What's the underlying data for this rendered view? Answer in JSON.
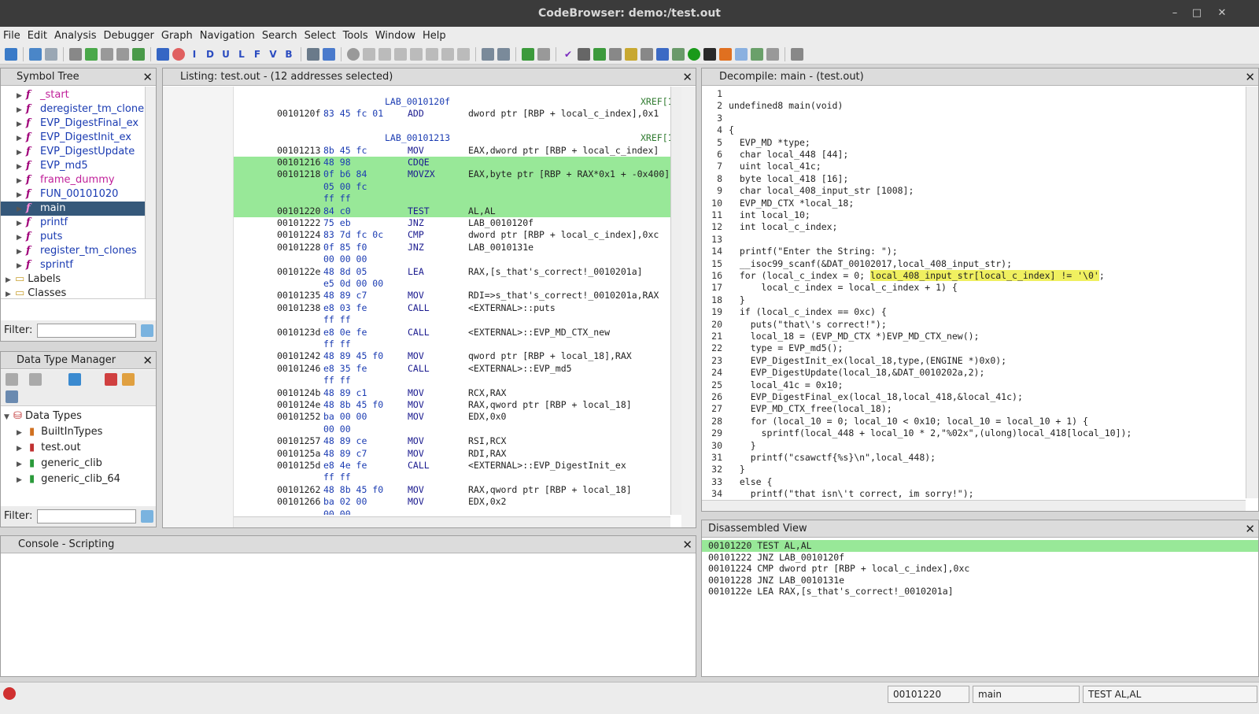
{
  "window": {
    "title": "CodeBrowser: demo:/test.out"
  },
  "menu": [
    "File",
    "Edit",
    "Analysis",
    "Debugger",
    "Graph",
    "Navigation",
    "Search",
    "Select",
    "Tools",
    "Window",
    "Help"
  ],
  "symbol_tree": {
    "title": "Symbol Tree",
    "items": [
      {
        "label": "_start",
        "kind": "fn"
      },
      {
        "label": "deregister_tm_clone",
        "kind": "fn"
      },
      {
        "label": "EVP_DigestFinal_ex",
        "kind": "thunk"
      },
      {
        "label": "EVP_DigestInit_ex",
        "kind": "thunk"
      },
      {
        "label": "EVP_DigestUpdate",
        "kind": "thunk"
      },
      {
        "label": "EVP_md5",
        "kind": "thunk"
      },
      {
        "label": "frame_dummy",
        "kind": "fn"
      },
      {
        "label": "FUN_00101020",
        "kind": "fn"
      },
      {
        "label": "main",
        "kind": "fn",
        "selected": true
      },
      {
        "label": "printf",
        "kind": "thunk"
      },
      {
        "label": "puts",
        "kind": "thunk"
      },
      {
        "label": "register_tm_clones",
        "kind": "fn"
      },
      {
        "label": "sprintf",
        "kind": "thunk"
      }
    ],
    "folders": [
      "Labels",
      "Classes"
    ],
    "filter_label": "Filter:"
  },
  "data_type_manager": {
    "title": "Data Type Manager",
    "root": "Data Types",
    "items": [
      "BuiltInTypes",
      "test.out",
      "generic_clib",
      "generic_clib_64"
    ],
    "filter_label": "Filter:"
  },
  "listing": {
    "title": "Listing:  test.out - (12 addresses selected)",
    "rows": [
      {
        "type": "label",
        "label": "LAB_0010120f",
        "xref": "XREF[1"
      },
      {
        "type": "ins",
        "addr": "0010120f",
        "bytes": "83 45 fc 01",
        "mn": "ADD",
        "op": "dword ptr [RBP + local_c_index],0x1"
      },
      {
        "type": "blank"
      },
      {
        "type": "label",
        "label": "LAB_00101213",
        "xref": "XREF[1"
      },
      {
        "type": "ins",
        "addr": "00101213",
        "bytes": "8b 45 fc",
        "mn": "MOV",
        "op": "EAX,dword ptr [RBP + local_c_index]"
      },
      {
        "type": "ins",
        "addr": "00101216",
        "bytes": "48 98",
        "mn": "CDQE",
        "op": "",
        "hl": true
      },
      {
        "type": "ins",
        "addr": "00101218",
        "bytes": "0f b6 84",
        "mn": "MOVZX",
        "op": "EAX,byte ptr [RBP + RAX*0x1 + -0x400]",
        "hl": true
      },
      {
        "type": "cont",
        "bytes": "05 00 fc",
        "hl": true
      },
      {
        "type": "cont",
        "bytes": "ff ff",
        "hl": true
      },
      {
        "type": "ins",
        "addr": "00101220",
        "bytes": "84 c0",
        "mn": "TEST",
        "op": "AL,AL",
        "hl": true
      },
      {
        "type": "ins",
        "addr": "00101222",
        "bytes": "75 eb",
        "mn": "JNZ",
        "op": "LAB_0010120f"
      },
      {
        "type": "ins",
        "addr": "00101224",
        "bytes": "83 7d fc 0c",
        "mn": "CMP",
        "op": "dword ptr [RBP + local_c_index],0xc"
      },
      {
        "type": "ins",
        "addr": "00101228",
        "bytes": "0f 85 f0",
        "mn": "JNZ",
        "op": "LAB_0010131e"
      },
      {
        "type": "cont",
        "bytes": "00 00 00"
      },
      {
        "type": "ins",
        "addr": "0010122e",
        "bytes": "48 8d 05",
        "mn": "LEA",
        "op": "RAX,[s_that's_correct!_0010201a]"
      },
      {
        "type": "cont",
        "bytes": "e5 0d 00 00"
      },
      {
        "type": "ins",
        "addr": "00101235",
        "bytes": "48 89 c7",
        "mn": "MOV",
        "op": "RDI=>s_that's_correct!_0010201a,RAX"
      },
      {
        "type": "ins",
        "addr": "00101238",
        "bytes": "e8 03 fe",
        "mn": "CALL",
        "op": "<EXTERNAL>::puts"
      },
      {
        "type": "cont",
        "bytes": "ff ff"
      },
      {
        "type": "ins",
        "addr": "0010123d",
        "bytes": "e8 0e fe",
        "mn": "CALL",
        "op": "<EXTERNAL>::EVP_MD_CTX_new"
      },
      {
        "type": "cont",
        "bytes": "ff ff"
      },
      {
        "type": "ins",
        "addr": "00101242",
        "bytes": "48 89 45 f0",
        "mn": "MOV",
        "op": "qword ptr [RBP + local_18],RAX"
      },
      {
        "type": "ins",
        "addr": "00101246",
        "bytes": "e8 35 fe",
        "mn": "CALL",
        "op": "<EXTERNAL>::EVP_md5"
      },
      {
        "type": "cont",
        "bytes": "ff ff"
      },
      {
        "type": "ins",
        "addr": "0010124b",
        "bytes": "48 89 c1",
        "mn": "MOV",
        "op": "RCX,RAX"
      },
      {
        "type": "ins",
        "addr": "0010124e",
        "bytes": "48 8b 45 f0",
        "mn": "MOV",
        "op": "RAX,qword ptr [RBP + local_18]"
      },
      {
        "type": "ins",
        "addr": "00101252",
        "bytes": "ba 00 00",
        "mn": "MOV",
        "op": "EDX,0x0"
      },
      {
        "type": "cont",
        "bytes": "00 00"
      },
      {
        "type": "ins",
        "addr": "00101257",
        "bytes": "48 89 ce",
        "mn": "MOV",
        "op": "RSI,RCX"
      },
      {
        "type": "ins",
        "addr": "0010125a",
        "bytes": "48 89 c7",
        "mn": "MOV",
        "op": "RDI,RAX"
      },
      {
        "type": "ins",
        "addr": "0010125d",
        "bytes": "e8 4e fe",
        "mn": "CALL",
        "op": "<EXTERNAL>::EVP_DigestInit_ex"
      },
      {
        "type": "cont",
        "bytes": "ff ff"
      },
      {
        "type": "ins",
        "addr": "00101262",
        "bytes": "48 8b 45 f0",
        "mn": "MOV",
        "op": "RAX,qword ptr [RBP + local_18]"
      },
      {
        "type": "ins",
        "addr": "00101266",
        "bytes": "ba 02 00",
        "mn": "MOV",
        "op": "EDX,0x2"
      },
      {
        "type": "cont",
        "bytes": "00 00"
      }
    ]
  },
  "decompile": {
    "title": "Decompile: main - (test.out)",
    "lines": [
      "",
      "undefined8 main(void)",
      "",
      "{",
      "  EVP_MD *type;",
      "  char local_448 [44];",
      "  uint local_41c;",
      "  byte local_418 [16];",
      "  char local_408_input_str [1008];",
      "  EVP_MD_CTX *local_18;",
      "  int local_10;",
      "  int local_c_index;",
      "",
      "  printf(\"Enter the String: \");",
      "  __isoc99_scanf(&DAT_00102017,local_408_input_str);",
      "  for (local_c_index = 0; local_408_input_str[local_c_index] != '\\0';",
      "      local_c_index = local_c_index + 1) {",
      "  }",
      "  if (local_c_index == 0xc) {",
      "    puts(\"that\\'s correct!\");",
      "    local_18 = (EVP_MD_CTX *)EVP_MD_CTX_new();",
      "    type = EVP_md5();",
      "    EVP_DigestInit_ex(local_18,type,(ENGINE *)0x0);",
      "    EVP_DigestUpdate(local_18,&DAT_0010202a,2);",
      "    local_41c = 0x10;",
      "    EVP_DigestFinal_ex(local_18,local_418,&local_41c);",
      "    EVP_MD_CTX_free(local_18);",
      "    for (local_10 = 0; local_10 < 0x10; local_10 = local_10 + 1) {",
      "      sprintf(local_448 + local_10 * 2,\"%02x\",(ulong)local_418[local_10]);",
      "    }",
      "    printf(\"csawctf{%s}\\n\",local_448);",
      "  }",
      "  else {",
      "    printf(\"that isn\\'t correct, im sorry!\");"
    ],
    "highlight_line": 16,
    "highlight_text": "local_408_input_str[local_c_index] != '\\0'"
  },
  "disassembled_view": {
    "title": "Disassembled View",
    "lines": [
      "00101220 TEST AL,AL",
      "00101222 JNZ LAB_0010120f",
      "00101224 CMP dword ptr [RBP + local_c_index],0xc",
      "00101228 JNZ LAB_0010131e",
      "0010122e LEA RAX,[s_that's_correct!_0010201a]"
    ]
  },
  "console": {
    "title": "Console - Scripting"
  },
  "status": {
    "address": "00101220",
    "function": "main",
    "instruction": "TEST AL,AL"
  },
  "colors": {
    "selection_green": "#98e898",
    "tree_selection": "#35587a",
    "function_pink": "#a0007a"
  }
}
